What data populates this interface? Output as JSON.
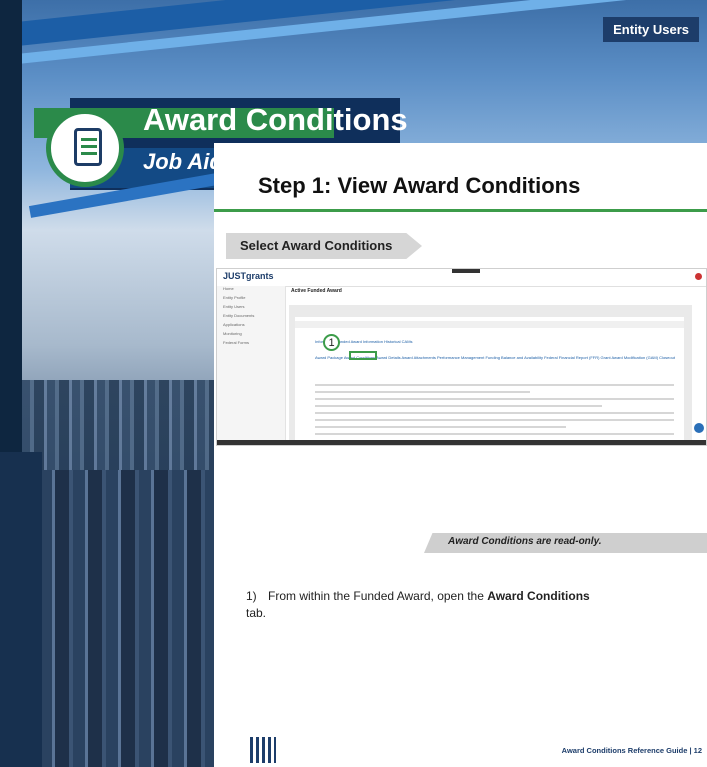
{
  "cover": {
    "badge_label": "Entity Users",
    "title": "Award Conditions",
    "subtitle": "Job Aid"
  },
  "page": {
    "step_title": "Step 1: View Award Conditions",
    "section_tab": "Select Award Conditions",
    "note": "Award Conditions are read-only.",
    "instruction": {
      "number": "1)",
      "text_before": "From within the Funded Award, open the ",
      "bold": "Award Conditions",
      "text_after": " tab."
    },
    "footer": "Award Conditions Reference Guide | 12"
  },
  "screenshot": {
    "logo": "JUSTgrants",
    "header": "Active Funded Award",
    "callout": "1",
    "tabs_row1": "Information     Funded Award Information     Historical CAMs",
    "tabs_row2": "Award Package   Award Conditions   Award Details   Award Attachments   Performance Management   Funding Balance and Availability   Federal Financial Report (FFR)   Grant Award Modification (GAM)   Closeout",
    "sidebar": [
      "Home",
      "Entity Profile",
      "Entity Users",
      "Entity Documents",
      "Applications",
      "Monitoring",
      "Federal Forms"
    ]
  },
  "colors": {
    "accent_green": "#3c9c4a",
    "navy": "#1d3d6a"
  }
}
